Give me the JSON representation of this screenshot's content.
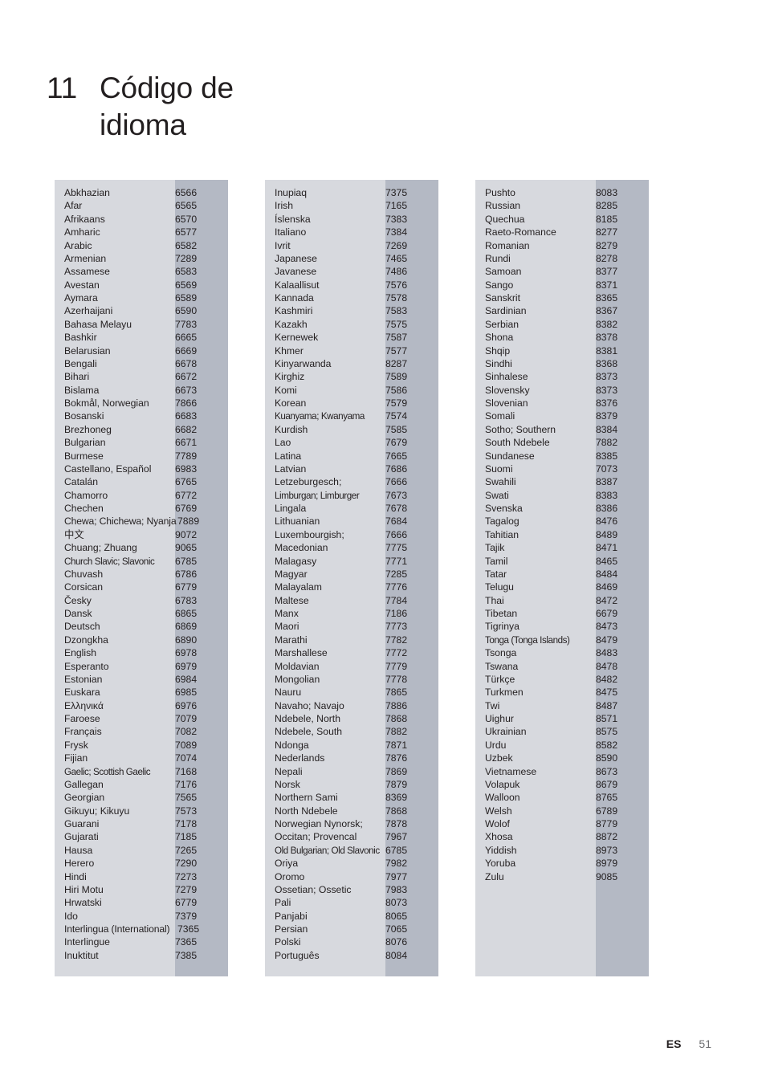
{
  "page": {
    "chapter_number": "11",
    "title": "Código de\nidioma",
    "title_line1": "Código de",
    "title_line2": "idioma"
  },
  "footer": {
    "locale": "ES",
    "page_number": "51"
  },
  "colors": {
    "panel_name_bg": "#d7d9de",
    "panel_code_bg": "#b4b9c4",
    "text": "#231f20",
    "page_number": "#6d6e71"
  },
  "table": {
    "columns": [
      {
        "id": "column-1",
        "rows": [
          {
            "language": "Abkhazian",
            "code": "6566"
          },
          {
            "language": "Afar",
            "code": "6565"
          },
          {
            "language": "Afrikaans",
            "code": "6570"
          },
          {
            "language": "Amharic",
            "code": "6577"
          },
          {
            "language": "Arabic",
            "code": "6582"
          },
          {
            "language": "Armenian",
            "code": "7289"
          },
          {
            "language": "Assamese",
            "code": "6583"
          },
          {
            "language": "Avestan",
            "code": "6569"
          },
          {
            "language": "Aymara",
            "code": "6589"
          },
          {
            "language": "Azerhaijani",
            "code": "6590"
          },
          {
            "language": "Bahasa Melayu",
            "code": "7783"
          },
          {
            "language": "Bashkir",
            "code": "6665"
          },
          {
            "language": "Belarusian",
            "code": "6669"
          },
          {
            "language": "Bengali",
            "code": "6678"
          },
          {
            "language": "Bihari",
            "code": "6672"
          },
          {
            "language": "Bislama",
            "code": "6673"
          },
          {
            "language": "Bokmål, Norwegian",
            "code": "7866"
          },
          {
            "language": "Bosanski",
            "code": "6683"
          },
          {
            "language": "Brezhoneg",
            "code": "6682"
          },
          {
            "language": "Bulgarian",
            "code": "6671"
          },
          {
            "language": "Burmese",
            "code": "7789"
          },
          {
            "language": "Castellano, Español",
            "code": "6983"
          },
          {
            "language": "Catalán",
            "code": "6765"
          },
          {
            "language": "Chamorro",
            "code": "6772"
          },
          {
            "language": "Chechen",
            "code": "6769"
          },
          {
            "language": "Chewa; Chichewa; Nyanja",
            "code": "7889",
            "style": "overflow"
          },
          {
            "language": "中文",
            "code": "9072",
            "style": "cjk"
          },
          {
            "language": "Chuang; Zhuang",
            "code": "9065"
          },
          {
            "language": "Church Slavic; Slavonic",
            "code": "6785",
            "style": "tight"
          },
          {
            "language": "Chuvash",
            "code": "6786"
          },
          {
            "language": "Corsican",
            "code": "6779"
          },
          {
            "language": "Česky",
            "code": "6783"
          },
          {
            "language": "Dansk",
            "code": "6865"
          },
          {
            "language": "Deutsch",
            "code": "6869"
          },
          {
            "language": "Dzongkha",
            "code": "6890"
          },
          {
            "language": "English",
            "code": "6978"
          },
          {
            "language": "Esperanto",
            "code": "6979"
          },
          {
            "language": "Estonian",
            "code": "6984"
          },
          {
            "language": "Euskara",
            "code": "6985"
          },
          {
            "language": "Ελληνικά",
            "code": "6976"
          },
          {
            "language": "Faroese",
            "code": "7079"
          },
          {
            "language": "Français",
            "code": "7082"
          },
          {
            "language": "Frysk",
            "code": "7089"
          },
          {
            "language": "Fijian",
            "code": "7074"
          },
          {
            "language": "Gaelic; Scottish Gaelic",
            "code": "7168",
            "style": "tight"
          },
          {
            "language": "Gallegan",
            "code": "7176"
          },
          {
            "language": "Georgian",
            "code": "7565"
          },
          {
            "language": "Gikuyu; Kikuyu",
            "code": "7573"
          },
          {
            "language": "Guarani",
            "code": "7178"
          },
          {
            "language": "Gujarati",
            "code": "7185"
          },
          {
            "language": "Hausa",
            "code": "7265"
          },
          {
            "language": "Herero",
            "code": "7290"
          },
          {
            "language": "Hindi",
            "code": "7273"
          },
          {
            "language": "Hiri Motu",
            "code": "7279"
          },
          {
            "language": "Hrwatski",
            "code": "6779"
          },
          {
            "language": "Ido",
            "code": "7379"
          },
          {
            "language": "Interlingua (International)",
            "code": "7365",
            "style": "overflow"
          },
          {
            "language": "Interlingue",
            "code": "7365"
          },
          {
            "language": "Inuktitut",
            "code": "7385"
          }
        ]
      },
      {
        "id": "column-2",
        "rows": [
          {
            "language": "Inupiaq",
            "code": "7375"
          },
          {
            "language": "Irish",
            "code": "7165"
          },
          {
            "language": "Íslenska",
            "code": "7383"
          },
          {
            "language": "Italiano",
            "code": "7384"
          },
          {
            "language": "Ivrit",
            "code": "7269"
          },
          {
            "language": "Japanese",
            "code": "7465"
          },
          {
            "language": "Javanese",
            "code": "7486"
          },
          {
            "language": "Kalaallisut",
            "code": "7576"
          },
          {
            "language": "Kannada",
            "code": "7578"
          },
          {
            "language": "Kashmiri",
            "code": "7583"
          },
          {
            "language": "Kazakh",
            "code": "7575"
          },
          {
            "language": "Kernewek",
            "code": "7587"
          },
          {
            "language": "Khmer",
            "code": "7577"
          },
          {
            "language": "Kinyarwanda",
            "code": "8287"
          },
          {
            "language": "Kirghiz",
            "code": "7589"
          },
          {
            "language": "Komi",
            "code": "7586"
          },
          {
            "language": "Korean",
            "code": "7579"
          },
          {
            "language": "Kuanyama; Kwanyama",
            "code": "7574",
            "style": "tight"
          },
          {
            "language": "Kurdish",
            "code": "7585"
          },
          {
            "language": "Lao",
            "code": "7679"
          },
          {
            "language": "Latina",
            "code": "7665"
          },
          {
            "language": "Latvian",
            "code": "7686"
          },
          {
            "language": "Letzeburgesch;",
            "code": "7666"
          },
          {
            "language": "Limburgan; Limburger",
            "code": "7673",
            "style": "tight"
          },
          {
            "language": "Lingala",
            "code": "7678"
          },
          {
            "language": "Lithuanian",
            "code": "7684"
          },
          {
            "language": "Luxembourgish;",
            "code": "7666"
          },
          {
            "language": "Macedonian",
            "code": "7775"
          },
          {
            "language": "Malagasy",
            "code": "7771"
          },
          {
            "language": "Magyar",
            "code": "7285"
          },
          {
            "language": "Malayalam",
            "code": "7776"
          },
          {
            "language": "Maltese",
            "code": "7784"
          },
          {
            "language": "Manx",
            "code": "7186"
          },
          {
            "language": "Maori",
            "code": "7773"
          },
          {
            "language": "Marathi",
            "code": "7782"
          },
          {
            "language": "Marshallese",
            "code": "7772"
          },
          {
            "language": "Moldavian",
            "code": "7779"
          },
          {
            "language": "Mongolian",
            "code": "7778"
          },
          {
            "language": "Nauru",
            "code": "7865"
          },
          {
            "language": "Navaho; Navajo",
            "code": "7886"
          },
          {
            "language": "Ndebele, North",
            "code": "7868"
          },
          {
            "language": "Ndebele, South",
            "code": "7882"
          },
          {
            "language": "Ndonga",
            "code": "7871"
          },
          {
            "language": "Nederlands",
            "code": "7876"
          },
          {
            "language": "Nepali",
            "code": "7869"
          },
          {
            "language": "Norsk",
            "code": "7879"
          },
          {
            "language": "Northern Sami",
            "code": "8369"
          },
          {
            "language": "North Ndebele",
            "code": "7868"
          },
          {
            "language": "Norwegian Nynorsk;",
            "code": "7878"
          },
          {
            "language": "Occitan; Provencal",
            "code": "7967"
          },
          {
            "language": "Old Bulgarian; Old Slavonic",
            "code": "6785",
            "style": "tight"
          },
          {
            "language": "Oriya",
            "code": "7982"
          },
          {
            "language": "Oromo",
            "code": "7977"
          },
          {
            "language": "Ossetian; Ossetic",
            "code": "7983"
          },
          {
            "language": "Pali",
            "code": "8073"
          },
          {
            "language": "Panjabi",
            "code": "8065"
          },
          {
            "language": "Persian",
            "code": "7065"
          },
          {
            "language": "Polski",
            "code": "8076"
          },
          {
            "language": "Português",
            "code": "8084"
          }
        ]
      },
      {
        "id": "column-3",
        "rows": [
          {
            "language": "Pushto",
            "code": "8083"
          },
          {
            "language": "Russian",
            "code": "8285"
          },
          {
            "language": "Quechua",
            "code": "8185"
          },
          {
            "language": "Raeto-Romance",
            "code": "8277"
          },
          {
            "language": "Romanian",
            "code": "8279"
          },
          {
            "language": "Rundi",
            "code": "8278"
          },
          {
            "language": "Samoan",
            "code": "8377"
          },
          {
            "language": "Sango",
            "code": "8371"
          },
          {
            "language": "Sanskrit",
            "code": "8365"
          },
          {
            "language": "Sardinian",
            "code": "8367"
          },
          {
            "language": "Serbian",
            "code": "8382"
          },
          {
            "language": "Shona",
            "code": "8378"
          },
          {
            "language": "Shqip",
            "code": "8381"
          },
          {
            "language": "Sindhi",
            "code": "8368"
          },
          {
            "language": "Sinhalese",
            "code": "8373"
          },
          {
            "language": "Slovensky",
            "code": "8373"
          },
          {
            "language": "Slovenian",
            "code": "8376"
          },
          {
            "language": "Somali",
            "code": "8379"
          },
          {
            "language": "Sotho; Southern",
            "code": "8384"
          },
          {
            "language": "South Ndebele",
            "code": "7882"
          },
          {
            "language": "Sundanese",
            "code": "8385"
          },
          {
            "language": "Suomi",
            "code": "7073"
          },
          {
            "language": "Swahili",
            "code": "8387"
          },
          {
            "language": "Swati",
            "code": "8383"
          },
          {
            "language": "Svenska",
            "code": "8386"
          },
          {
            "language": "Tagalog",
            "code": "8476"
          },
          {
            "language": "Tahitian",
            "code": "8489"
          },
          {
            "language": "Tajik",
            "code": "8471"
          },
          {
            "language": "Tamil",
            "code": "8465"
          },
          {
            "language": "Tatar",
            "code": "8484"
          },
          {
            "language": "Telugu",
            "code": "8469"
          },
          {
            "language": "Thai",
            "code": "8472"
          },
          {
            "language": "Tibetan",
            "code": "6679"
          },
          {
            "language": "Tigrinya",
            "code": "8473"
          },
          {
            "language": "Tonga (Tonga Islands)",
            "code": "8479",
            "style": "tight"
          },
          {
            "language": "Tsonga",
            "code": "8483"
          },
          {
            "language": "Tswana",
            "code": "8478"
          },
          {
            "language": "Türkçe",
            "code": "8482"
          },
          {
            "language": "Turkmen",
            "code": "8475"
          },
          {
            "language": "Twi",
            "code": "8487"
          },
          {
            "language": "Uighur",
            "code": "8571"
          },
          {
            "language": "Ukrainian",
            "code": "8575"
          },
          {
            "language": "Urdu",
            "code": "8582"
          },
          {
            "language": "Uzbek",
            "code": "8590"
          },
          {
            "language": "Vietnamese",
            "code": "8673"
          },
          {
            "language": "Volapuk",
            "code": "8679"
          },
          {
            "language": "Walloon",
            "code": "8765"
          },
          {
            "language": "Welsh",
            "code": "6789"
          },
          {
            "language": "Wolof",
            "code": "8779"
          },
          {
            "language": "Xhosa",
            "code": "8872"
          },
          {
            "language": "Yiddish",
            "code": "8973"
          },
          {
            "language": "Yoruba",
            "code": "8979"
          },
          {
            "language": "Zulu",
            "code": "9085"
          }
        ]
      }
    ]
  }
}
